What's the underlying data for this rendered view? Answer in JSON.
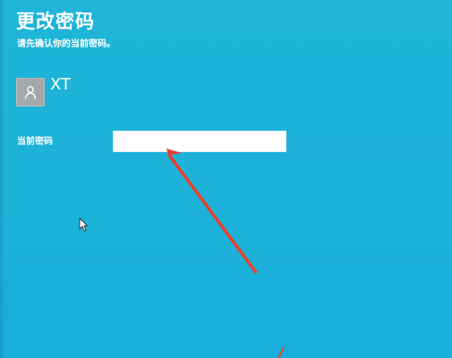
{
  "header": {
    "title": "更改密码",
    "subtitle": "请先确认你的当前密码。"
  },
  "account": {
    "username": "XT",
    "avatar_icon": "user-icon"
  },
  "form": {
    "current_password_label": "当前密码",
    "current_password_value": ""
  },
  "colors": {
    "background": "#1fb4d8",
    "text": "#ffffff",
    "input_background": "#ffffff",
    "avatar_background": "#a4a7ab",
    "annotation_arrow": "#e8402e"
  },
  "icons": {
    "pointer": "mouse-pointer-icon",
    "annotation": "red-arrow-icon"
  }
}
